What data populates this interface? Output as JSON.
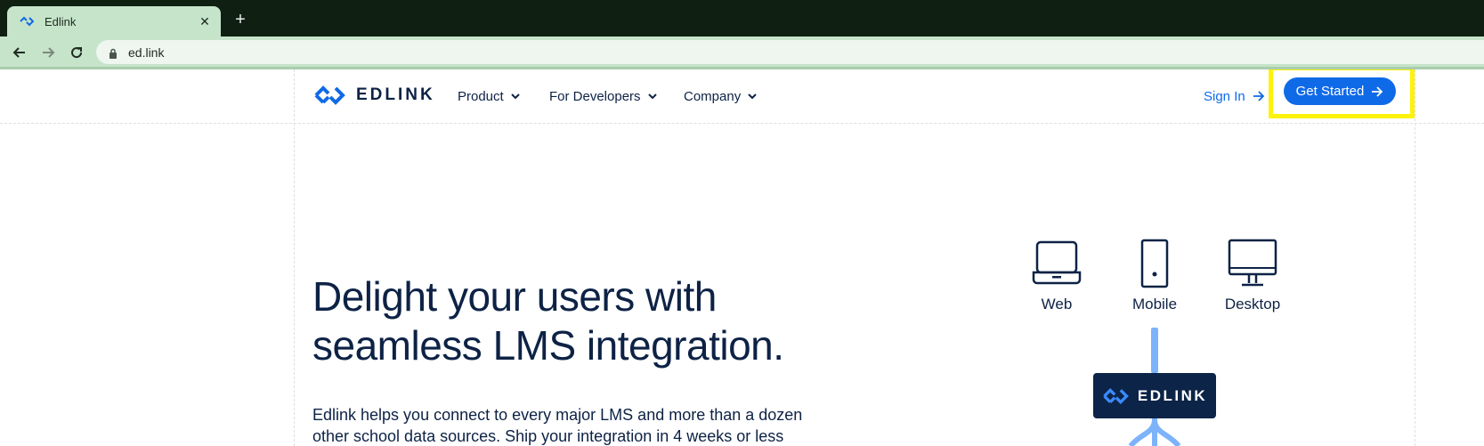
{
  "browser": {
    "tab_title": "Edlink",
    "tab_close": "✕",
    "new_tab": "+",
    "url": "ed.link"
  },
  "header": {
    "brand": "EDLINK",
    "menu": [
      {
        "label": "Product"
      },
      {
        "label": "For Developers"
      },
      {
        "label": "Company"
      }
    ],
    "sign_in": "Sign In",
    "get_started": "Get Started"
  },
  "hero": {
    "headline_line1": "Delight your users with",
    "headline_line2": "seamless LMS integration.",
    "subtext_line1": "Edlink helps you connect to every major LMS and more than a dozen",
    "subtext_line2": "other school data sources. Ship your integration in 4 weeks or less"
  },
  "diagram": {
    "devices": [
      {
        "label": "Web",
        "icon": "laptop-icon"
      },
      {
        "label": "Mobile",
        "icon": "phone-icon"
      },
      {
        "label": "Desktop",
        "icon": "monitor-icon"
      }
    ],
    "hub_label": "EDLINK"
  },
  "colors": {
    "brand_blue": "#0f6ae8",
    "navy": "#0d2245",
    "connector_blue": "#7db3fb",
    "highlight_yellow": "#fdf20c",
    "tab_bar": "#0f1f12",
    "tab_active": "#c5e4c9"
  }
}
